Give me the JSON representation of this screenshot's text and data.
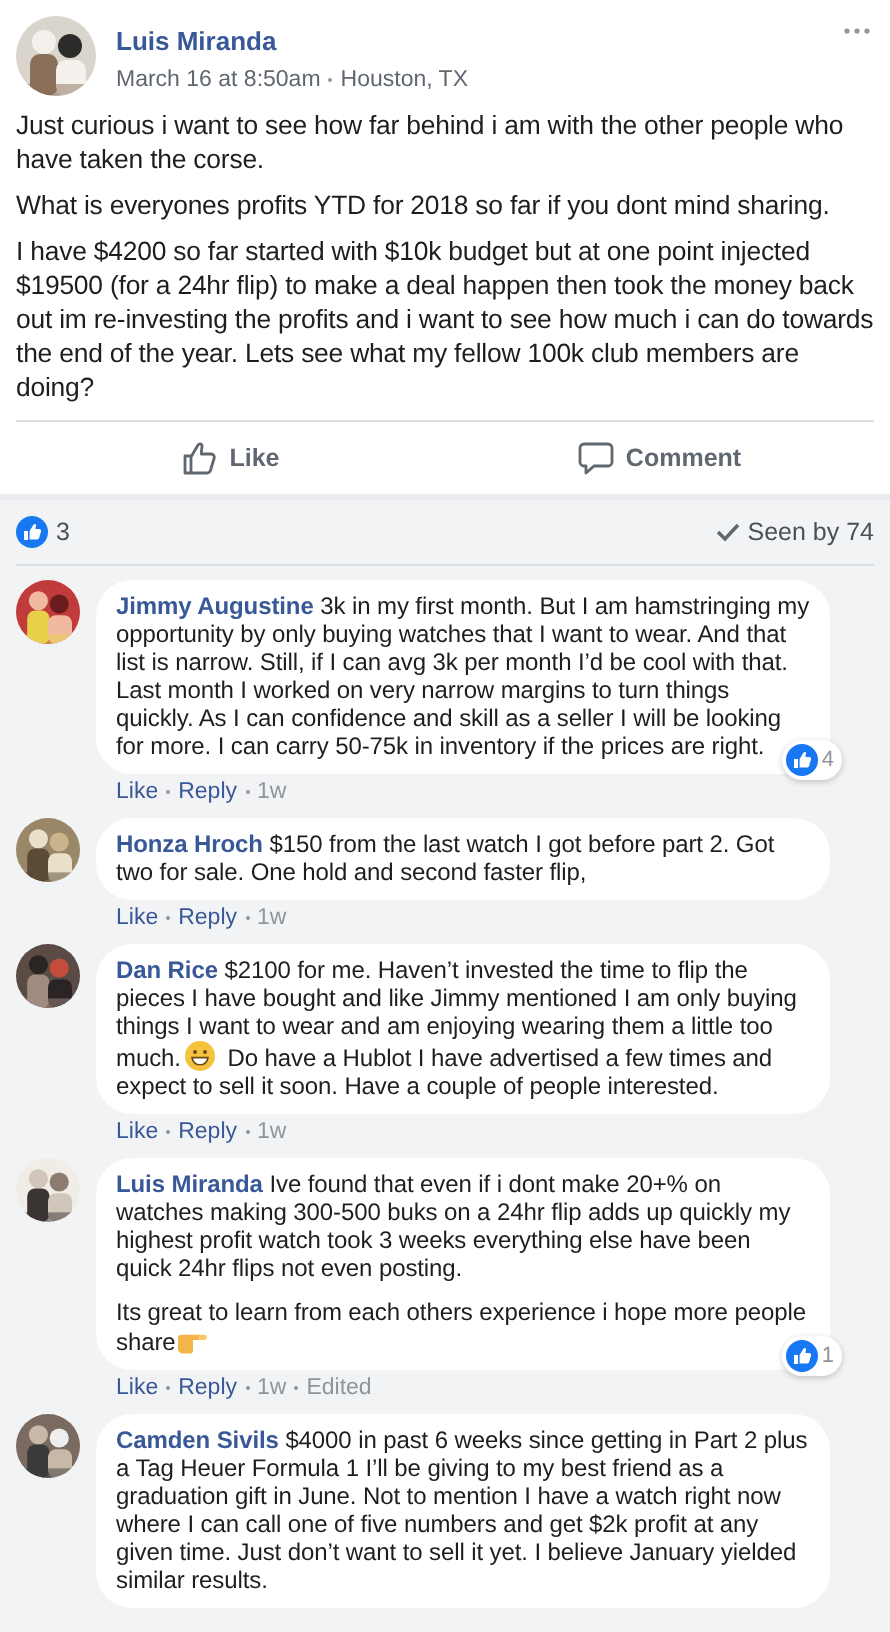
{
  "post": {
    "author": "Luis Miranda",
    "time": "March 16 at 8:50am",
    "location": "Houston, TX",
    "paragraphs": [
      "Just curious i want to see how far behind i am with the other people who have taken the corse.",
      "What is everyones profits YTD for 2018 so far if you dont mind sharing.",
      "I have $4200 so far started with $10k budget but at one point injected $19500 (for a 24hr flip) to make a deal happen then took the money back out im re-investing the profits and i want to see how much i can do towards the end of the year. Lets see what my fellow 100k club members are doing?"
    ],
    "actions": [
      {
        "kind": "like",
        "label": "Like"
      },
      {
        "kind": "comment",
        "label": "Comment"
      }
    ],
    "reactions_count": "3",
    "seen_by": "Seen by 74"
  },
  "comments": [
    {
      "author": "Jimmy Augustine",
      "paragraphs": [
        [
          {
            "kind": "text",
            "text": "3k in my first month. But I am hamstringing my opportunity by only buying watches that I want to wear. And that list is narrow. Still, if I can avg 3k per month I’d be cool with that. Last month I worked on very narrow margins to turn things quickly. As I can confidence and skill as a seller I will be looking for more. I can carry 50-75k in inventory if the prices are right."
          }
        ]
      ],
      "meta": [
        "Like",
        "Reply",
        "1w"
      ],
      "reactions": "4"
    },
    {
      "author": "Honza Hroch",
      "paragraphs": [
        [
          {
            "kind": "text",
            "text": "$150 from the last watch I got before part 2. Got two for sale. One hold and second faster flip,"
          }
        ]
      ],
      "meta": [
        "Like",
        "Reply",
        "1w"
      ]
    },
    {
      "author": "Dan Rice",
      "paragraphs": [
        [
          {
            "kind": "text",
            "text": "$2100 for me. Haven’t invested the time to flip the pieces I have bought and like Jimmy mentioned I am only buying things I want to wear and am enjoying wearing them a little too much."
          },
          {
            "kind": "smile"
          },
          {
            "kind": "text",
            "text": "Do have a Hublot I have advertised a few times and expect to sell it soon. Have a couple of people interested."
          }
        ]
      ],
      "meta": [
        "Like",
        "Reply",
        "1w"
      ]
    },
    {
      "author": "Luis Miranda",
      "paragraphs": [
        [
          {
            "kind": "text",
            "text": "Ive found that even if i dont make 20+% on watches making 300-500 buks on a 24hr flip adds up quickly my highest profit watch took 3 weeks everything else have been quick 24hr flips not even posting."
          }
        ],
        [
          {
            "kind": "text",
            "text": "Its great to learn from each others experience i hope more people share"
          },
          {
            "kind": "point"
          }
        ]
      ],
      "meta": [
        "Like",
        "Reply",
        "1w",
        "Edited"
      ],
      "reactions": "1"
    },
    {
      "author": "Camden Sivils",
      "paragraphs": [
        [
          {
            "kind": "text",
            "text": "$4000 in past 6 weeks since getting in Part 2 plus a Tag Heuer Formula 1 I’ll be giving to my best friend as a graduation gift in June. Not to mention I have a watch right now where I can call one of five numbers and get $2k profit at any given time. Just don’t want to sell it yet. I believe January yielded similar results."
          }
        ]
      ]
    }
  ]
}
